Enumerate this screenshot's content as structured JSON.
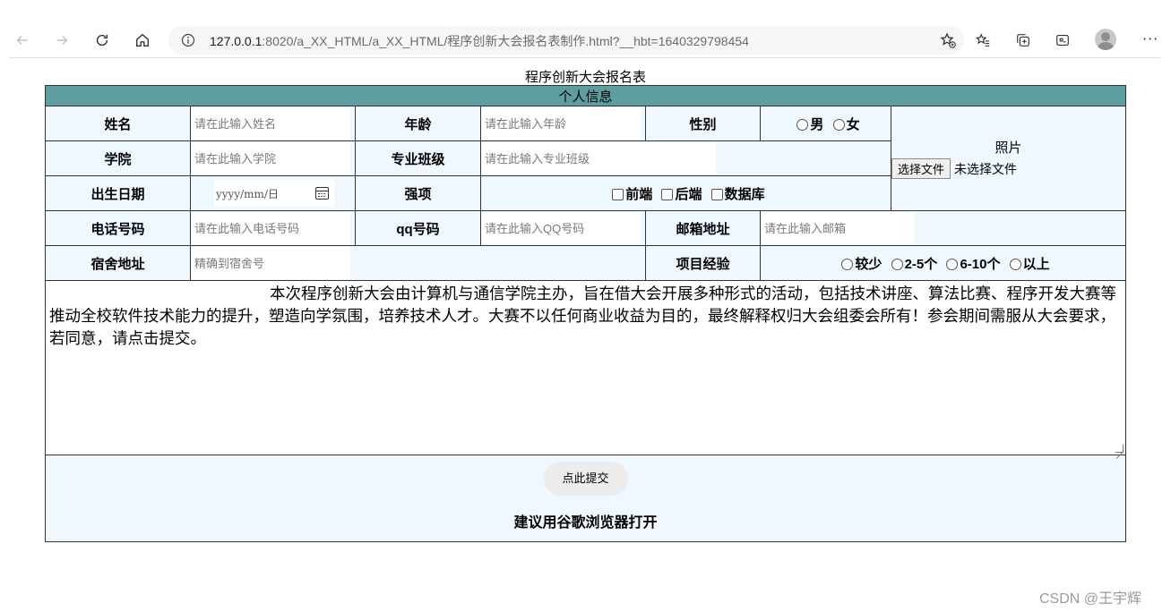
{
  "browser": {
    "url_host": "127.0.0.1",
    "url_rest": ":8020/a_XX_HTML/a_XX_HTML/程序创新大会报名表制作.html?__hbt=1640329798454",
    "icons": [
      "back-arrow-icon",
      "forward-arrow-icon",
      "refresh-icon",
      "home-icon",
      "info-icon",
      "add-favorite-icon",
      "favorites-icon",
      "collections-icon",
      "screenshot-icon",
      "profile-avatar",
      "more-icon"
    ]
  },
  "form": {
    "title": "程序创新大会报名表",
    "section_header": "个人信息",
    "name_label": "姓名",
    "name_placeholder": "请在此输入姓名",
    "age_label": "年龄",
    "age_placeholder": "请在此输入年龄",
    "gender_label": "性别",
    "gender_options": [
      "男",
      "女"
    ],
    "photo_label": "照片",
    "file_button": "选择文件",
    "file_status": "未选择文件",
    "college_label": "学院",
    "college_placeholder": "请在此输入学院",
    "major_label": "专业班级",
    "major_placeholder": "请在此输入专业班级",
    "birth_label": "出生日期",
    "birth_placeholder": "yyyy/mm/日",
    "skills_label": "强项",
    "skills_options": [
      "前端",
      "后端",
      "数据库"
    ],
    "phone_label": "电话号码",
    "phone_placeholder": "请在此输入电话号码",
    "qq_label": "qq号码",
    "qq_placeholder": "请在此输入QQ号码",
    "email_label": "邮箱地址",
    "email_placeholder": "请在此输入邮箱",
    "dorm_label": "宿舍地址",
    "dorm_placeholder": "精确到宿舍号",
    "exp_label": "项目经验",
    "exp_options": [
      "较少",
      "2-5个",
      "6-10个",
      "以上"
    ],
    "intro_text": "本次程序创新大会由计算机与通信学院主办，旨在借大会开展多种形式的活动，包括技术讲座、算法比赛、程序开发大赛等推动全校软件技术能力的提升，塑造向学氛围，培养技术人才。大赛不以任何商业收益为目的，最终解释权归大会组委会所有！参会期间需服从大会要求，若同意，请点击提交。",
    "submit_label": "点此提交",
    "note": "建议用谷歌浏览器打开"
  },
  "watermark": "CSDN @王宇辉",
  "colors": {
    "header_bg": "#5f9ea0",
    "cell_bg": "#f0f8ff"
  }
}
